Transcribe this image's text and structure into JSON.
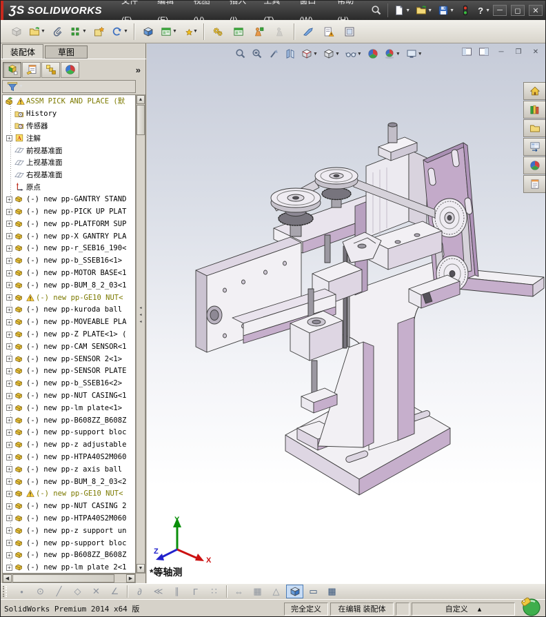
{
  "window": {
    "logo_mark": "ƷS",
    "logo_text": "SOLIDWORKS",
    "controls": [
      {
        "name": "minimize-button",
        "glyph": "─"
      },
      {
        "name": "maximize-button",
        "glyph": "◻"
      },
      {
        "name": "close-button",
        "glyph": "✕"
      }
    ],
    "help_glyph": "?"
  },
  "menubar": {
    "items": [
      "文件(F)",
      "编辑(E)",
      "视图(V)",
      "插入(I)",
      "工具(T)",
      "窗口(W)",
      "帮助(H)"
    ]
  },
  "quick_access": {
    "items": [
      {
        "name": "search-icon",
        "icon": "magnifier-dark"
      },
      {
        "name": "new-document-icon",
        "icon": "page",
        "dropdown": true
      },
      {
        "name": "open-document-icon",
        "icon": "folder-open",
        "dropdown": true
      },
      {
        "name": "save-icon",
        "icon": "floppy",
        "dropdown": true
      },
      {
        "name": "rebuild-indicator-icon",
        "icon": "traffic"
      },
      {
        "name": "help-icon",
        "glyph": "?",
        "dropdown": true
      }
    ]
  },
  "main_toolbar": {
    "items": [
      {
        "name": "insert-components-icon",
        "icon": "cube-gray",
        "disabled": true
      },
      {
        "name": "open-part-icon",
        "icon": "folder-open",
        "dropdown": true
      },
      {
        "name": "mate-icon",
        "icon": "paperclip"
      },
      {
        "name": "linear-component-pattern-icon",
        "icon": "pattern-dots",
        "dropdown": true
      },
      {
        "name": "smart-fasteners-icon",
        "icon": "star-box"
      },
      {
        "name": "move-component-icon",
        "icon": "rotate",
        "dropdown": true
      },
      {
        "sep": true
      },
      {
        "name": "show-hidden-components-icon",
        "icon": "cube-blue"
      },
      {
        "name": "assembly-features-icon",
        "icon": "window-green",
        "dropdown": true
      },
      {
        "name": "reference-geometry-icon",
        "icon": "gold-star",
        "dropdown": true
      },
      {
        "sep": true
      },
      {
        "name": "interference-detection-icon",
        "icon": "gears"
      },
      {
        "name": "assembly-visualization-icon",
        "icon": "window-green"
      },
      {
        "name": "instant3d-icon",
        "icon": "figure-orange"
      },
      {
        "name": "motion-study-icon",
        "icon": "figure-gray",
        "disabled": true
      },
      {
        "sep": true
      },
      {
        "name": "exploded-line-sketch-icon",
        "icon": "blade"
      },
      {
        "name": "assemblyxpert-icon",
        "icon": "doc-warning"
      },
      {
        "name": "large-design-review-icon",
        "icon": "doc-frame"
      }
    ]
  },
  "panel": {
    "tabs": [
      {
        "label": "装配体",
        "active": true
      },
      {
        "label": "草图",
        "active": false
      }
    ],
    "header_icons": [
      {
        "name": "featuremanager-tab-icon",
        "icon": "tree-mgr",
        "active": true
      },
      {
        "name": "propertymanager-tab-icon",
        "icon": "form-hand"
      },
      {
        "name": "configurationmanager-tab-icon",
        "icon": "config-stack"
      },
      {
        "name": "displaymanager-tab-icon",
        "icon": "color-wheel"
      }
    ],
    "overflow_glyph": "»",
    "filter": {
      "name": "filter-icon",
      "icon": "funnel",
      "dropdown": true
    }
  },
  "tree": {
    "items": [
      {
        "icon": "assembly",
        "warn": true,
        "olive": true,
        "root": true,
        "label": "ASSM PICK AND PLACE  (默"
      },
      {
        "icon": "folder-clock",
        "label": "History"
      },
      {
        "icon": "folder-gauge",
        "label": "传感器"
      },
      {
        "icon": "note-a",
        "exp": true,
        "label": "注解"
      },
      {
        "icon": "plane",
        "label": "前视基准面"
      },
      {
        "icon": "plane",
        "label": "上视基准面"
      },
      {
        "icon": "plane",
        "label": "右视基准面"
      },
      {
        "icon": "origin",
        "label": "原点"
      },
      {
        "icon": "part",
        "exp": true,
        "label": "(-) new pp-GANTRY STAND"
      },
      {
        "icon": "part",
        "exp": true,
        "label": "(-) new pp-PICK UP PLAT"
      },
      {
        "icon": "part",
        "exp": true,
        "label": "(-) new pp-PLATFORM SUP"
      },
      {
        "icon": "part",
        "exp": true,
        "label": "(-) new pp-X GANTRY PLA"
      },
      {
        "icon": "part",
        "exp": true,
        "label": "(-) new pp-r_SEB16_190<"
      },
      {
        "icon": "part",
        "exp": true,
        "label": "(-) new pp-b_SSEB16<1>"
      },
      {
        "icon": "part",
        "exp": true,
        "label": "(-) new pp-MOTOR BASE<1"
      },
      {
        "icon": "part",
        "exp": true,
        "label": "(-) new pp-BUM_8_2_03<1"
      },
      {
        "icon": "part",
        "exp": true,
        "warn": true,
        "olive": true,
        "label": "(-) new pp-GE10 NUT<"
      },
      {
        "icon": "part",
        "exp": true,
        "label": "(-) new pp-kuroda ball"
      },
      {
        "icon": "part",
        "exp": true,
        "label": "(-) new pp-MOVEABLE PLA"
      },
      {
        "icon": "part",
        "exp": true,
        "label": "(-) new pp-Z PLATE<1> ("
      },
      {
        "icon": "part",
        "exp": true,
        "label": "(-) new pp-CAM SENSOR<1"
      },
      {
        "icon": "part",
        "exp": true,
        "label": "(-) new pp-SENSOR 2<1>"
      },
      {
        "icon": "part",
        "exp": true,
        "label": "(-) new pp-SENSOR PLATE"
      },
      {
        "icon": "part",
        "exp": true,
        "label": "(-) new pp-b_SSEB16<2>"
      },
      {
        "icon": "part",
        "exp": true,
        "label": "(-) new pp-NUT CASING<1"
      },
      {
        "icon": "part",
        "exp": true,
        "label": "(-) new pp-lm plate<1>"
      },
      {
        "icon": "part",
        "exp": true,
        "label": "(-) new pp-B608ZZ_B608Z"
      },
      {
        "icon": "part",
        "exp": true,
        "label": "(-) new pp-support bloc"
      },
      {
        "icon": "part",
        "exp": true,
        "label": "(-) new pp-z adjustable"
      },
      {
        "icon": "part",
        "exp": true,
        "label": "(-) new pp-HTPA40S2M060"
      },
      {
        "icon": "part",
        "exp": true,
        "label": "(-) new pp-z axis ball"
      },
      {
        "icon": "part",
        "exp": true,
        "label": "(-) new pp-BUM_8_2_03<2"
      },
      {
        "icon": "part",
        "exp": true,
        "warn": true,
        "olive": true,
        "label": "(-) new pp-GE10 NUT<"
      },
      {
        "icon": "part",
        "exp": true,
        "label": "(-) new pp-NUT CASING 2"
      },
      {
        "icon": "part",
        "exp": true,
        "label": "(-) new pp-HTPA40S2M060"
      },
      {
        "icon": "part",
        "exp": true,
        "label": "(-) new pp-z support un"
      },
      {
        "icon": "part",
        "exp": true,
        "label": "(-) new pp-support bloc"
      },
      {
        "icon": "part",
        "exp": true,
        "label": "(-) new pp-B608ZZ_B608Z"
      },
      {
        "icon": "part",
        "exp": true,
        "label": "(-) new pp-lm plate 2<1"
      }
    ]
  },
  "viewport": {
    "view_label": "*等轴测",
    "triad": {
      "x": "X",
      "y": "Y",
      "z": "Z"
    },
    "headsup": [
      {
        "name": "zoom-to-fit-icon",
        "icon": "magnifier"
      },
      {
        "name": "zoom-to-area-icon",
        "icon": "magnifier-area"
      },
      {
        "name": "zoom-about-icon",
        "icon": "pointer"
      },
      {
        "name": "section-view-icon",
        "icon": "section"
      },
      {
        "name": "view-orientation-icon",
        "icon": "cube-grid",
        "dropdown": true
      },
      {
        "name": "display-style-icon",
        "icon": "cube-white",
        "dropdown": true
      },
      {
        "name": "hide-show-items-icon",
        "icon": "glasses",
        "dropdown": true
      },
      {
        "name": "edit-appearance-icon",
        "icon": "sphere"
      },
      {
        "name": "apply-scene-icon",
        "icon": "sphere-scene",
        "dropdown": true
      },
      {
        "name": "view-settings-icon",
        "icon": "monitor",
        "dropdown": true
      }
    ],
    "mdi": [
      {
        "name": "doc-window-pane-left-button",
        "icon": "pane-l"
      },
      {
        "name": "doc-window-pane-right-button",
        "icon": "pane-r"
      },
      {
        "name": "doc-minimize-button",
        "glyph": "─"
      },
      {
        "name": "doc-restore-button",
        "glyph": "❐"
      },
      {
        "name": "doc-close-button",
        "glyph": "✕"
      }
    ]
  },
  "taskpane": {
    "items": [
      {
        "name": "solidworks-resources-icon",
        "icon": "home"
      },
      {
        "name": "design-library-icon",
        "icon": "books"
      },
      {
        "name": "file-explorer-icon",
        "icon": "folder"
      },
      {
        "name": "view-palette-icon",
        "icon": "palette"
      },
      {
        "name": "appearances-scenes-icon",
        "icon": "sphere"
      },
      {
        "name": "custom-properties-icon",
        "icon": "form"
      }
    ]
  },
  "sketch_toolbar": {
    "items": [
      {
        "name": "point-tool-icon",
        "glyph": "•"
      },
      {
        "name": "circle-tool-icon",
        "glyph": "⊙"
      },
      {
        "name": "line-tool-icon",
        "glyph": "╱"
      },
      {
        "name": "polygon-tool-icon",
        "glyph": "◇"
      },
      {
        "name": "trim-tool-icon",
        "glyph": "✕"
      },
      {
        "name": "angle-tool-icon",
        "glyph": "∠"
      },
      {
        "sep": true
      },
      {
        "name": "spline-tool-icon",
        "glyph": "∂"
      },
      {
        "name": "mirror-tool-icon",
        "glyph": "≪"
      },
      {
        "name": "offset-tool-icon",
        "glyph": "∥"
      },
      {
        "name": "corner-tool-icon",
        "glyph": "Γ"
      },
      {
        "name": "pattern-tool-icon",
        "glyph": "∷"
      },
      {
        "sep": true
      },
      {
        "name": "convert-entities-icon",
        "glyph": "⇔"
      },
      {
        "name": "grid-icon",
        "glyph": "▦"
      },
      {
        "name": "triangle-icon",
        "glyph": "△"
      },
      {
        "name": "shaded-with-edges-icon",
        "icon": "cube-blue",
        "active": true
      },
      {
        "name": "viewport-single-icon",
        "glyph": "▭",
        "enabled": true
      },
      {
        "name": "viewport-grid-icon",
        "glyph": "▦",
        "enabled": true
      }
    ]
  },
  "statusbar": {
    "product": "SolidWorks Premium 2014 x64 版",
    "cells": [
      "完全定义",
      "在编辑 装配体",
      "",
      "自定义"
    ],
    "custom_arrow": "▴"
  },
  "colors": {
    "model_lavender": "#c6afcc",
    "model_white": "#f2f0f4",
    "warning_text": "#7c7a00",
    "viewport_top": "#c6cbd8"
  }
}
